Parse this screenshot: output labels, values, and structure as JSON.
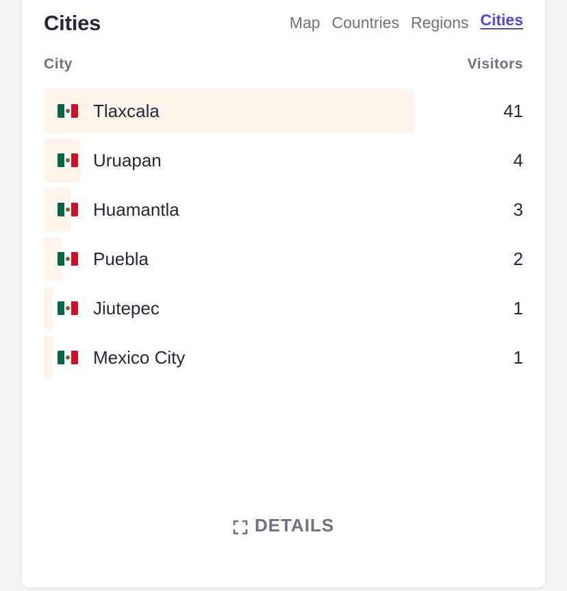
{
  "card": {
    "title": "Cities",
    "tabs": [
      {
        "label": "Map",
        "active": false
      },
      {
        "label": "Countries",
        "active": false
      },
      {
        "label": "Regions",
        "active": false
      },
      {
        "label": "Cities",
        "active": true
      }
    ],
    "columns": {
      "left": "City",
      "right": "Visitors"
    },
    "rows": [
      {
        "flag_icon": "mexico-flag-icon",
        "city": "Tlaxcala",
        "visitors": "41",
        "share": 1.0
      },
      {
        "flag_icon": "mexico-flag-icon",
        "city": "Uruapan",
        "visitors": "4",
        "share": 0.098
      },
      {
        "flag_icon": "mexico-flag-icon",
        "city": "Huamantla",
        "visitors": "3",
        "share": 0.073
      },
      {
        "flag_icon": "mexico-flag-icon",
        "city": "Puebla",
        "visitors": "2",
        "share": 0.049
      },
      {
        "flag_icon": "mexico-flag-icon",
        "city": "Jiutepec",
        "visitors": "1",
        "share": 0.024
      },
      {
        "flag_icon": "mexico-flag-icon",
        "city": "Mexico City",
        "visitors": "1",
        "share": 0.024
      }
    ],
    "details_label": "DETAILS",
    "details_icon": "expand-icon"
  },
  "colors": {
    "accent": "#4f46e5",
    "bar": "#fff4ea",
    "text": "#1f2937",
    "muted": "#6b7280"
  }
}
